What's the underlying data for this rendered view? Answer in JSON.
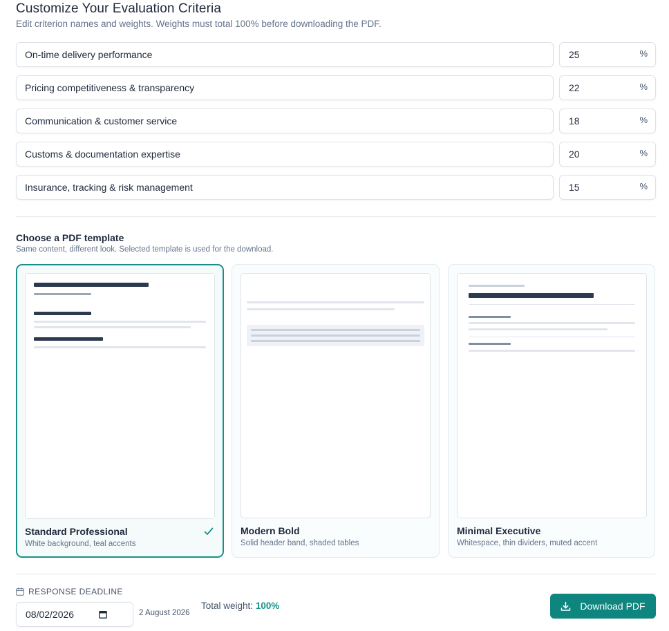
{
  "header": {
    "title": "Customize Your Evaluation Criteria",
    "subtitle": "Edit criterion names and weights. Weights must total 100% before downloading the PDF."
  },
  "criteria": [
    {
      "name": "On-time delivery performance",
      "weight": "25",
      "unit": "%"
    },
    {
      "name": "Pricing competitiveness & transparency",
      "weight": "22",
      "unit": "%"
    },
    {
      "name": "Communication & customer service",
      "weight": "18",
      "unit": "%"
    },
    {
      "name": "Customs & documentation expertise",
      "weight": "20",
      "unit": "%"
    },
    {
      "name": "Insurance, tracking & risk management",
      "weight": "15",
      "unit": "%"
    }
  ],
  "templates": {
    "title": "Choose a PDF template",
    "subtitle": "Same content, different look. Selected template is used for the download.",
    "items": [
      {
        "name": "Standard Professional",
        "description": "White background, teal accents",
        "selected": true
      },
      {
        "name": "Modern Bold",
        "description": "Solid header band, shaded tables",
        "selected": false
      },
      {
        "name": "Minimal Executive",
        "description": "Whitespace, thin dividers, muted accent",
        "selected": false
      }
    ]
  },
  "footer": {
    "deadline_label": "RESPONSE DEADLINE",
    "deadline_value": "08/02/2026",
    "deadline_human": "2 August 2026",
    "total_label": "Total weight:",
    "total_value": "100%",
    "download_label": "Download PDF"
  },
  "icons": {
    "calendar": "calendar-icon",
    "check": "check-icon",
    "download": "download-icon"
  },
  "colors": {
    "accent": "#0f857f",
    "accent_text": "#17908a",
    "border": "#dde2e8",
    "text": "#1e293b",
    "muted": "#64748b"
  }
}
